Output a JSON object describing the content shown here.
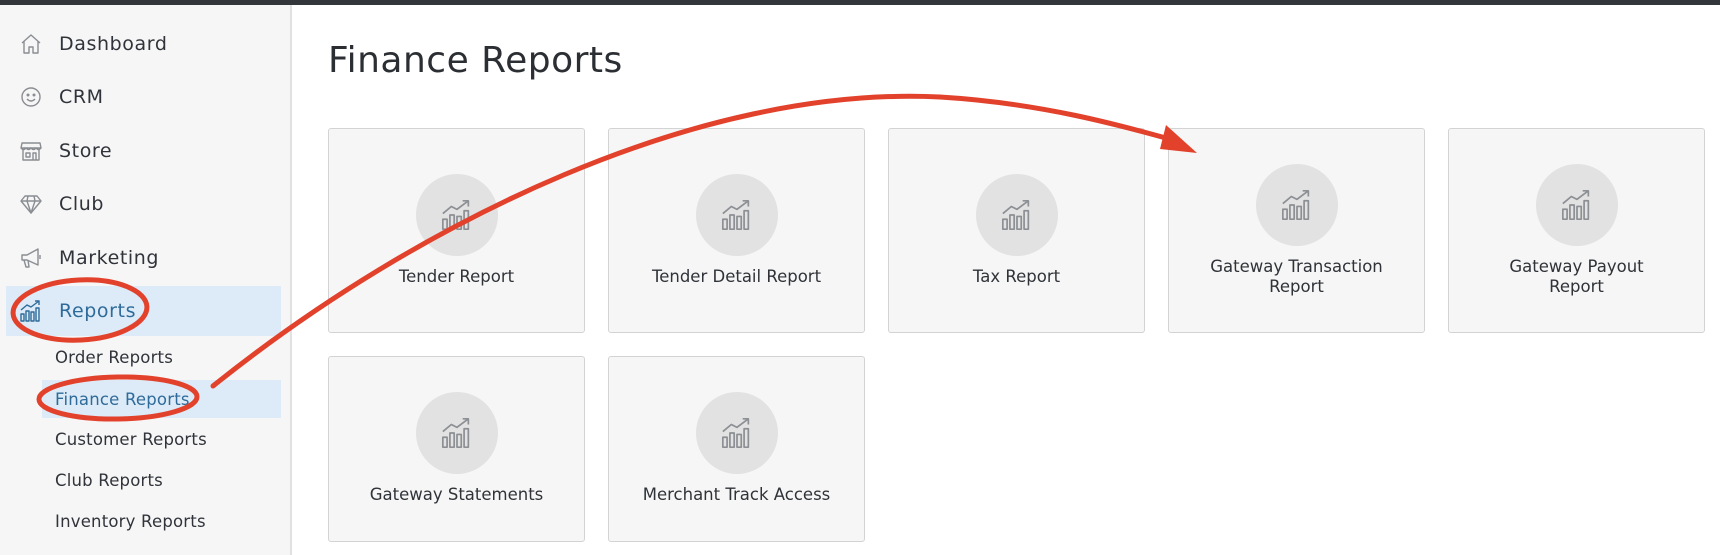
{
  "sidebar": {
    "items": [
      {
        "label": "Dashboard",
        "icon": "home-icon"
      },
      {
        "label": "CRM",
        "icon": "smiley-icon"
      },
      {
        "label": "Store",
        "icon": "store-icon"
      },
      {
        "label": "Club",
        "icon": "diamond-icon"
      },
      {
        "label": "Marketing",
        "icon": "megaphone-icon"
      },
      {
        "label": "Reports",
        "icon": "chart-icon",
        "active": true
      }
    ],
    "subitems": [
      {
        "label": "Order Reports"
      },
      {
        "label": "Finance Reports",
        "active": true
      },
      {
        "label": "Customer Reports"
      },
      {
        "label": "Club Reports"
      },
      {
        "label": "Inventory Reports"
      }
    ]
  },
  "main": {
    "title": "Finance Reports",
    "cards": [
      {
        "label": "Tender Report",
        "icon": "chart-icon"
      },
      {
        "label": "Tender Detail Report",
        "icon": "chart-icon"
      },
      {
        "label": "Tax Report",
        "icon": "chart-icon"
      },
      {
        "label": "Gateway Transaction Report",
        "icon": "chart-icon"
      },
      {
        "label": "Gateway Payout Report",
        "icon": "chart-icon"
      },
      {
        "label": "Gateway Statements",
        "icon": "chart-icon"
      },
      {
        "label": "Merchant Track Access",
        "icon": "chart-icon"
      }
    ]
  },
  "colors": {
    "active_bg": "#dcebf7",
    "active_text": "#2f6b9a",
    "annotation_red": "#e2422c",
    "card_bg": "#f6f6f6",
    "icon_circle": "#e2e2e2"
  }
}
